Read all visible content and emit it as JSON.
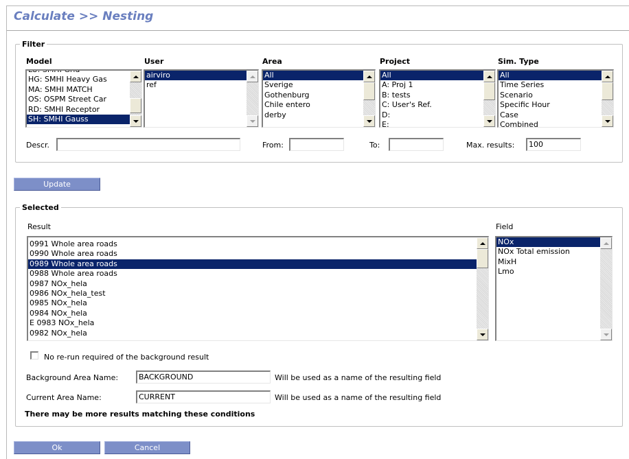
{
  "title": "Calculate >> Nesting",
  "filter": {
    "legend": "Filter",
    "model": {
      "label": "Model",
      "items": [
        "LU: SMHI Grid",
        "HG: SMHI Heavy Gas",
        "MA: SMHI MATCH",
        "OS: OSPM Street Car",
        "RD: SMHI Receptor",
        "SH: SMHI Gauss"
      ],
      "selected": "SH: SMHI Gauss"
    },
    "user": {
      "label": "User",
      "items": [
        "airviro",
        "ref"
      ],
      "selected": "airviro"
    },
    "area": {
      "label": "Area",
      "items": [
        "All",
        "Sverige",
        "Gothenburg",
        "Chile entero",
        "derby"
      ],
      "selected": "All"
    },
    "project": {
      "label": "Project",
      "items": [
        "All",
        "A: Proj 1",
        "B: tests",
        "C: User's Ref.",
        "D:",
        "E:"
      ],
      "selected": "All"
    },
    "simtype": {
      "label": "Sim. Type",
      "items": [
        "All",
        "Time Series",
        "Scenario",
        "Specific Hour",
        "Case",
        "Combined"
      ],
      "selected": "All"
    },
    "descr_label": "Descr.",
    "descr_value": "",
    "from_label": "From:",
    "from_value": "",
    "to_label": "To:",
    "to_value": "",
    "maxresults_label": "Max. results:",
    "maxresults_value": "100"
  },
  "update_label": "Update",
  "selected": {
    "legend": "Selected",
    "result_label": "Result",
    "results": [
      "0991 Whole area roads",
      "0990 Whole area roads",
      "0989 Whole area roads",
      "0988 Whole area roads",
      "0987 NOx_hela",
      "0986 NOx_hela_test",
      "0985 NOx_hela",
      "0984 NOx_hela",
      "E 0983 NOx_hela",
      "0982 NOx_hela"
    ],
    "result_selected": "0989 Whole area roads",
    "field_label": "Field",
    "fields": [
      "NOx",
      "NOx Total emission",
      "MixH",
      "Lmo"
    ],
    "field_selected": "NOx",
    "checkbox_label": "No re-run required of the background result",
    "checkbox_checked": false,
    "background_label": "Background Area Name:",
    "background_value": "BACKGROUND",
    "background_hint": "Will be used as a name of the resulting field",
    "current_label": "Current Area Name:",
    "current_value": "CURRENT",
    "current_hint": "Will be used as a name of the resulting field",
    "notice": "There may be more results matching these conditions"
  },
  "ok_label": "Ok",
  "cancel_label": "Cancel",
  "colors": {
    "title": "#6a7fbf",
    "button": "#7d8fc8",
    "selection": "#0a246a"
  }
}
